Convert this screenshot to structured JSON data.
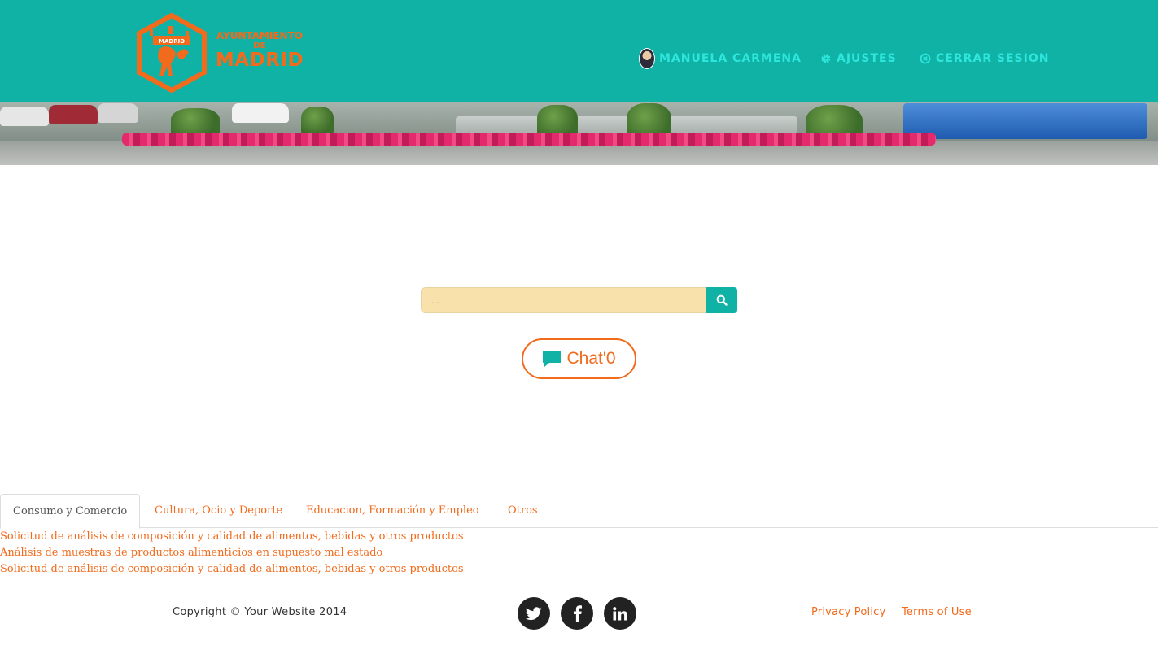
{
  "header": {
    "logo": {
      "badge_text": "MADRID",
      "line1": "AYUNTAMIENTO",
      "line2": "DE",
      "line3": "MADRID"
    },
    "nav": {
      "user_name": "MANUELA CARMENA",
      "settings_label": "AJUSTES",
      "logout_label": "CERRAR SESION"
    }
  },
  "search": {
    "placeholder": "..."
  },
  "chat": {
    "label": "Chat'0"
  },
  "tabs": [
    {
      "label": "Consumo y Comercio",
      "active": true
    },
    {
      "label": "Cultura, Ocio y Deporte",
      "active": false
    },
    {
      "label": "Educacion, Formación y Empleo",
      "active": false
    },
    {
      "label": "Otros",
      "active": false
    }
  ],
  "procedures": [
    "Solicitud de análisis de composición y calidad de alimentos, bebidas y otros productos",
    "Análisis de muestras de productos alimenticios en supuesto mal estado",
    "Solicitud de análisis de composición y calidad de alimentos, bebidas y otros productos"
  ],
  "footer": {
    "copyright": "Copyright © Your Website 2014",
    "privacy": "Privacy Policy",
    "terms": "Terms of Use",
    "social": [
      "twitter-icon",
      "facebook-icon",
      "linkedin-icon"
    ]
  },
  "colors": {
    "header_bg": "#11b2a6",
    "nav_text": "#2de6dc",
    "accent": "#f26a1b",
    "search_bg": "#f9e1ac"
  }
}
